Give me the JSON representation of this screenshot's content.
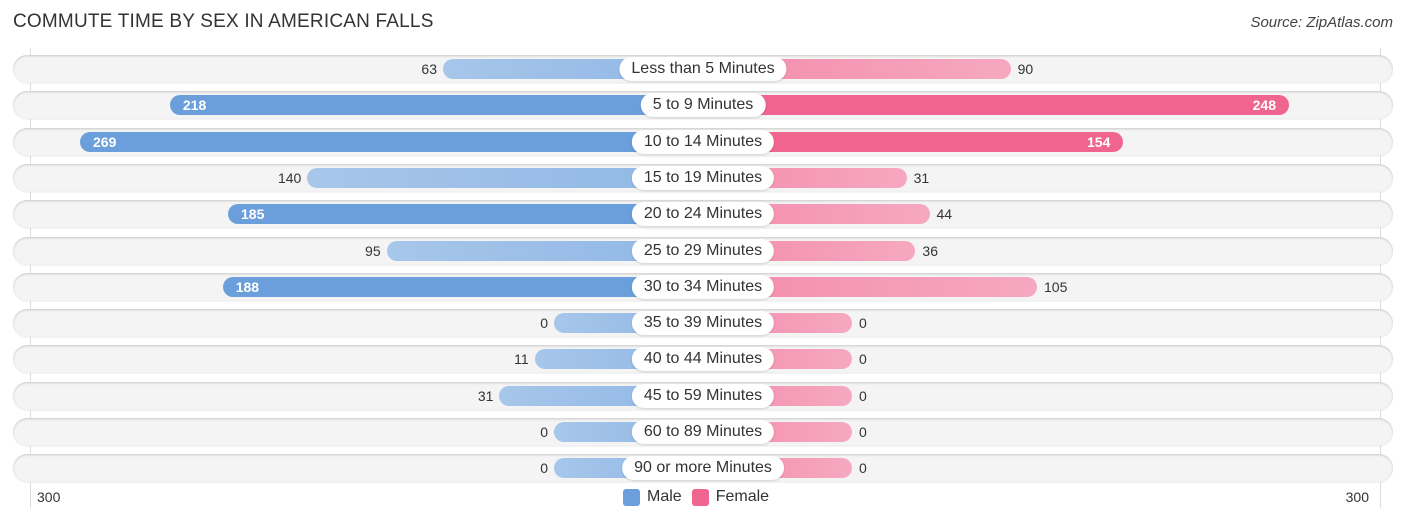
{
  "chart_data": {
    "type": "bar",
    "orientation": "diverging-horizontal",
    "title": "COMMUTE TIME BY SEX IN AMERICAN FALLS",
    "source": "Source: ZipAtlas.com",
    "categories": [
      "Less than 5 Minutes",
      "5 to 9 Minutes",
      "10 to 14 Minutes",
      "15 to 19 Minutes",
      "20 to 24 Minutes",
      "25 to 29 Minutes",
      "30 to 34 Minutes",
      "35 to 39 Minutes",
      "40 to 44 Minutes",
      "45 to 59 Minutes",
      "60 to 89 Minutes",
      "90 or more Minutes"
    ],
    "series": [
      {
        "name": "Male",
        "color": "#6a9fdc",
        "light_color": "#a7c6ea",
        "values": [
          63,
          218,
          269,
          140,
          185,
          95,
          188,
          0,
          11,
          31,
          0,
          0
        ]
      },
      {
        "name": "Female",
        "color": "#f06590",
        "light_color": "#f6a8c0",
        "values": [
          90,
          248,
          154,
          31,
          44,
          36,
          105,
          0,
          0,
          0,
          0,
          0
        ]
      }
    ],
    "axis": {
      "left_tick": "300",
      "right_tick": "300",
      "max": 300
    },
    "legend": {
      "position": "bottom-center",
      "items": [
        "Male",
        "Female"
      ]
    }
  }
}
